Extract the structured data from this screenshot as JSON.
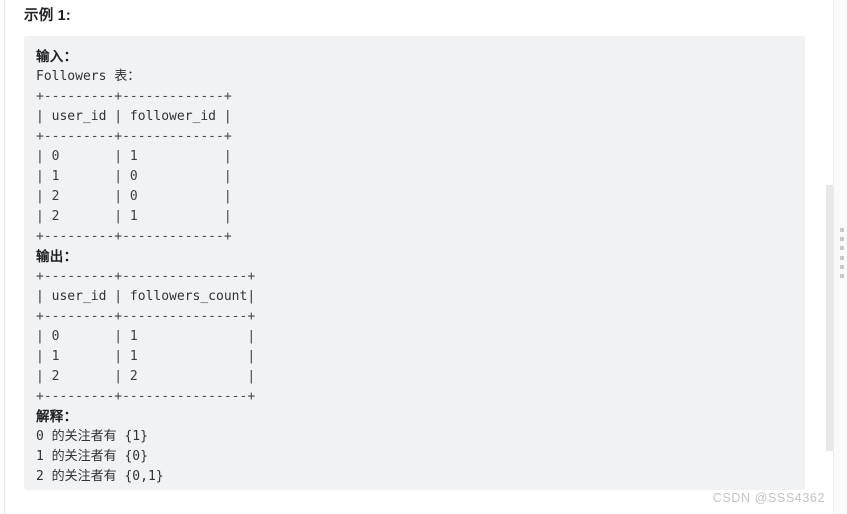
{
  "page": {
    "title": "示例 1:",
    "background": "#ffffff",
    "code_block_bg": "#f1f2f3"
  },
  "example": {
    "input_label": "输入：",
    "input_table_name": "Followers 表：",
    "input_table": {
      "rule": "+---------+-------------+",
      "header": "| user_id | follower_id |",
      "rows": [
        "| 0       | 1           |",
        "| 1       | 0           |",
        "| 2       | 0           |",
        "| 2       | 1           |"
      ]
    },
    "output_label": "输出：",
    "output_table": {
      "rule": "+---------+----------------+",
      "header": "| user_id | followers_count|",
      "rows": [
        "| 0       | 1              |",
        "| 1       | 1              |",
        "| 2       | 2              |"
      ]
    },
    "explanation_label": "解释：",
    "explanation_lines": [
      "0 的关注者有 {1}",
      "1 的关注者有 {0}",
      "2 的关注者有 {0,1}"
    ]
  },
  "scrollbar": {
    "position_percent": 40
  },
  "watermark": {
    "text": "CSDN @SSS4362"
  }
}
